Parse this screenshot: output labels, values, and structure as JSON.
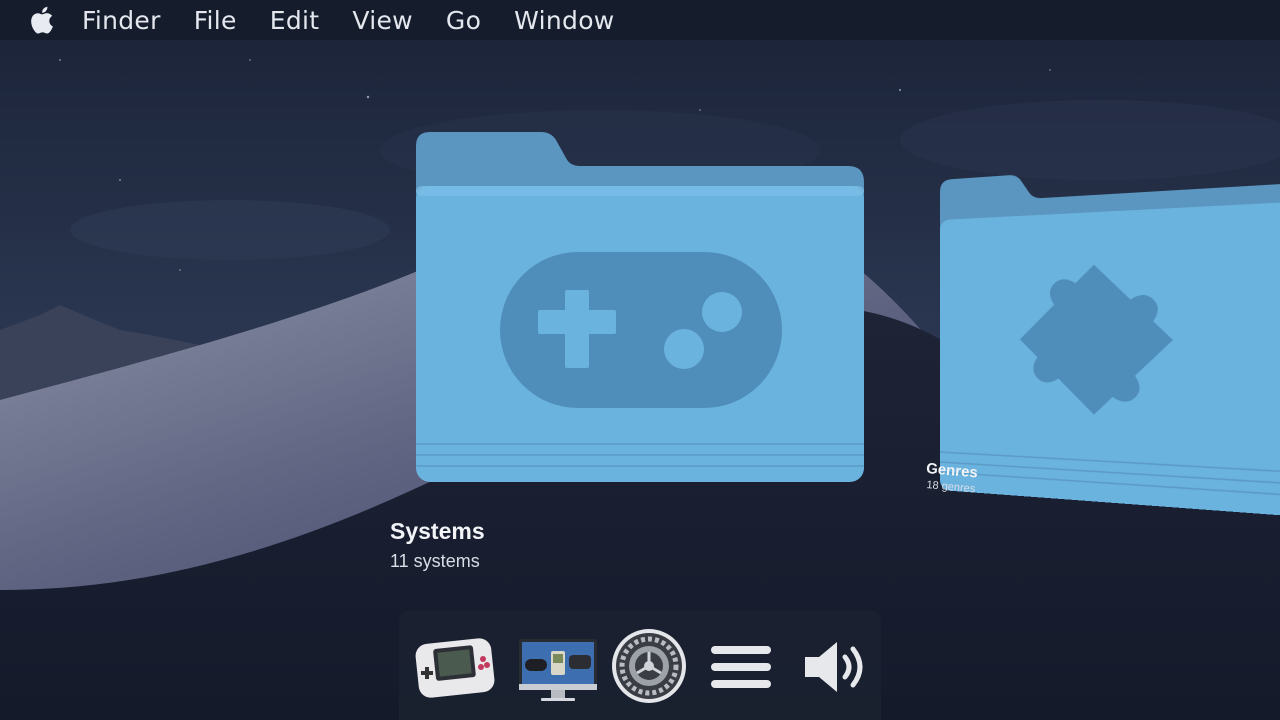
{
  "menubar": {
    "items": [
      "Finder",
      "File",
      "Edit",
      "View",
      "Go",
      "Window"
    ]
  },
  "icons": {
    "apple": "apple-logo-icon",
    "systems_folder": "gamepad-icon",
    "genres_folder": "puzzle-piece-icon",
    "dock": [
      "handheld-console-icon",
      "monitor-consoles-icon",
      "settings-gear-icon",
      "menu-icon",
      "volume-icon"
    ]
  },
  "folders": {
    "systems": {
      "title": "Systems",
      "subtitle": "11 systems"
    },
    "genres": {
      "title": "Genres",
      "subtitle": "18 genres"
    }
  },
  "colors": {
    "folder": "#6bb3df",
    "folder_dark": "#4f8fbd",
    "accent_icon": "#4f8dbb"
  }
}
